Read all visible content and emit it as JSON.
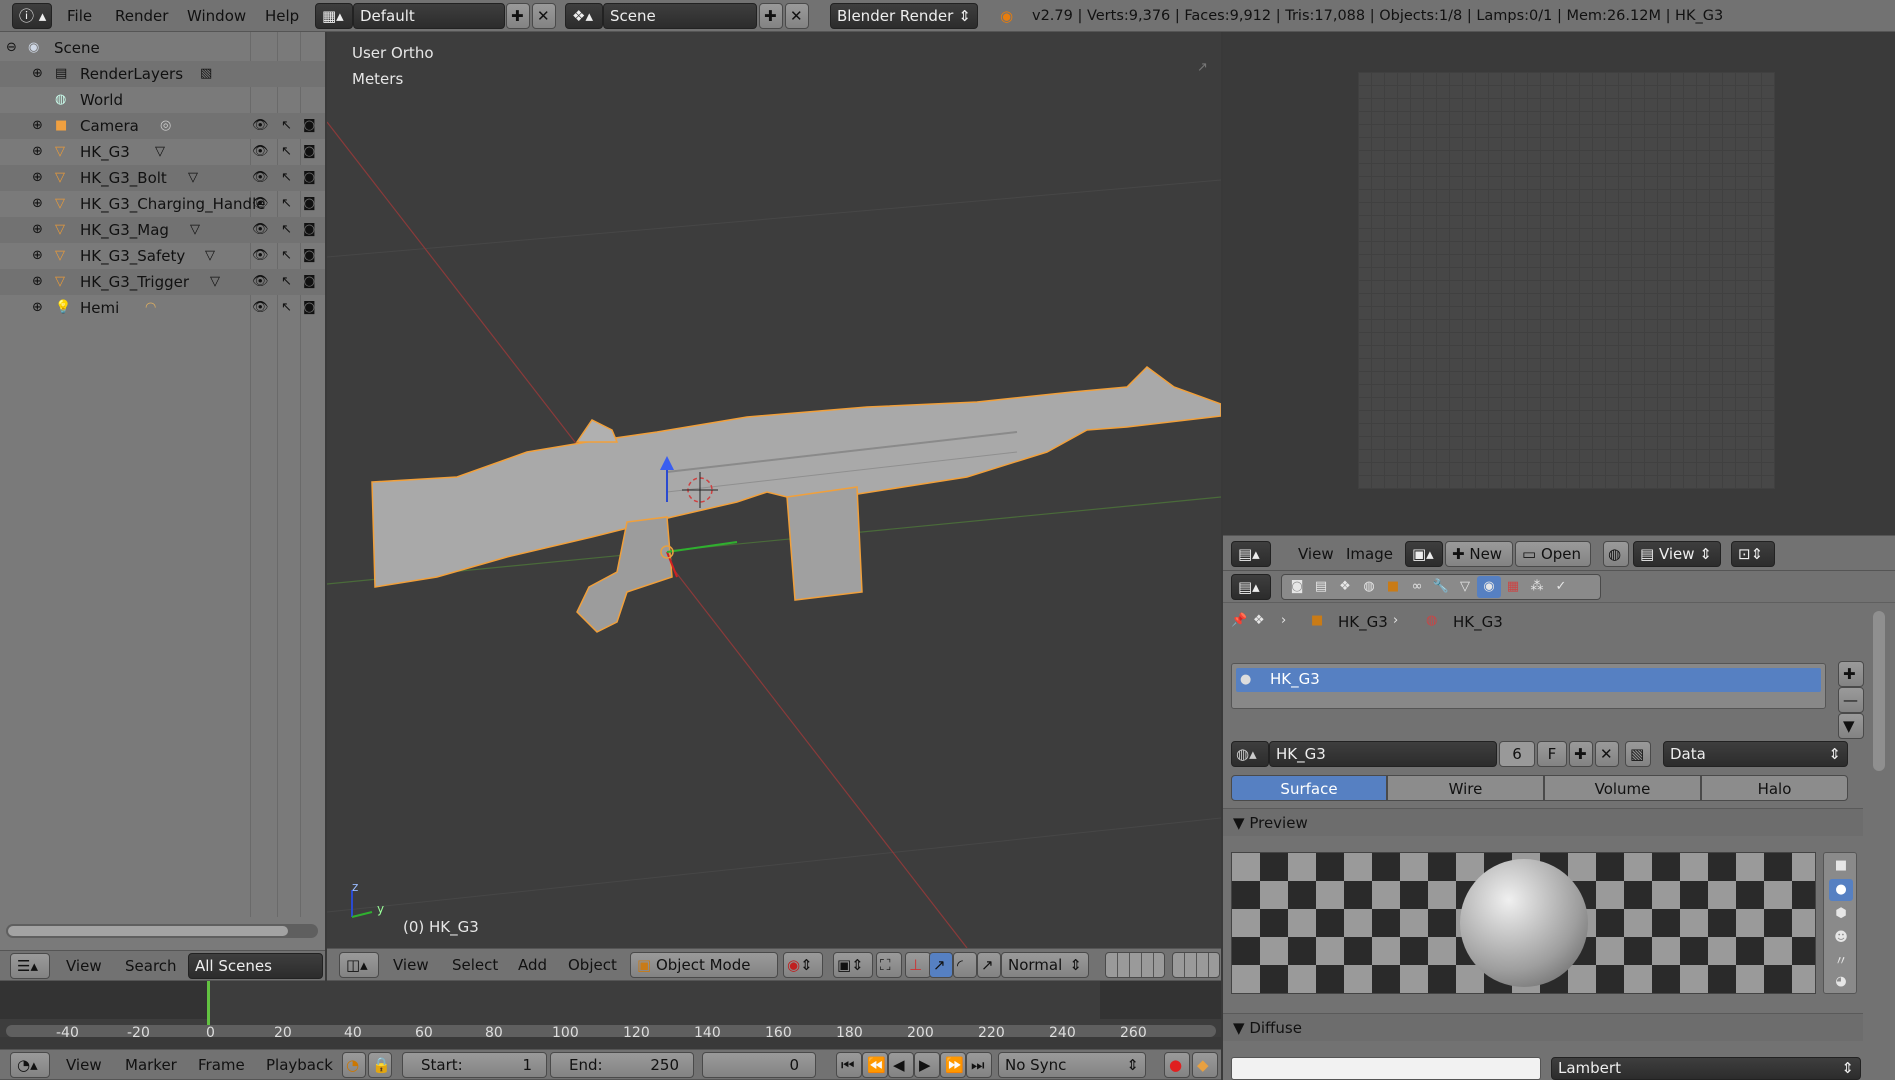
{
  "info_header": {
    "menus": [
      "File",
      "Render",
      "Window",
      "Help"
    ],
    "screen_layout": "Default",
    "scene": "Scene",
    "engine": "Blender Render",
    "stats": "v2.79 | Verts:9,376 | Faces:9,912 | Tris:17,088 | Objects:1/8 | Lamps:0/1 | Mem:26.12M | HK_G3"
  },
  "outliner": {
    "items": [
      {
        "label": "Scene"
      },
      {
        "label": "RenderLayers"
      },
      {
        "label": "World"
      },
      {
        "label": "Camera"
      },
      {
        "label": "HK_G3"
      },
      {
        "label": "HK_G3_Bolt"
      },
      {
        "label": "HK_G3_Charging_Handle"
      },
      {
        "label": "HK_G3_Mag"
      },
      {
        "label": "HK_G3_Safety"
      },
      {
        "label": "HK_G3_Trigger"
      },
      {
        "label": "Hemi"
      }
    ],
    "footer": {
      "view": "View",
      "search": "Search",
      "filter": "All Scenes"
    }
  },
  "viewport": {
    "view_name": "User Ortho",
    "units": "Meters",
    "object_label": "(0) HK_G3",
    "axis_z": "z",
    "axis_y": "y",
    "footer": {
      "menus": [
        "View",
        "Select",
        "Add",
        "Object"
      ],
      "mode": "Object Mode",
      "orientation": "Normal"
    }
  },
  "image_editor": {
    "header": {
      "view": "View",
      "image": "Image",
      "new": "New",
      "open": "Open",
      "view2": "View"
    }
  },
  "properties": {
    "breadcrumb": {
      "object": "HK_G3",
      "material": "HK_G3"
    },
    "slot": "HK_G3",
    "material_name": "HK_G3",
    "users": "6",
    "fake": "F",
    "link": "Data",
    "tabs": [
      "Surface",
      "Wire",
      "Volume",
      "Halo"
    ],
    "selected_tab": "Surface",
    "preview_panel": "Preview",
    "diffuse_panel": "Diffuse",
    "diffuse_shader": "Lambert"
  },
  "timeline": {
    "ticks": [
      "-40",
      "-20",
      "0",
      "20",
      "40",
      "60",
      "80",
      "100",
      "120",
      "140",
      "160",
      "180",
      "200",
      "220",
      "240",
      "260"
    ],
    "footer": {
      "menus": [
        "View",
        "Marker",
        "Frame",
        "Playback"
      ],
      "start_label": "Start:",
      "start": "1",
      "end_label": "End:",
      "end": "250",
      "current": "0",
      "sync": "No Sync"
    }
  },
  "colors": {
    "accent": "#5680c2",
    "selection": "#f1a03b"
  }
}
